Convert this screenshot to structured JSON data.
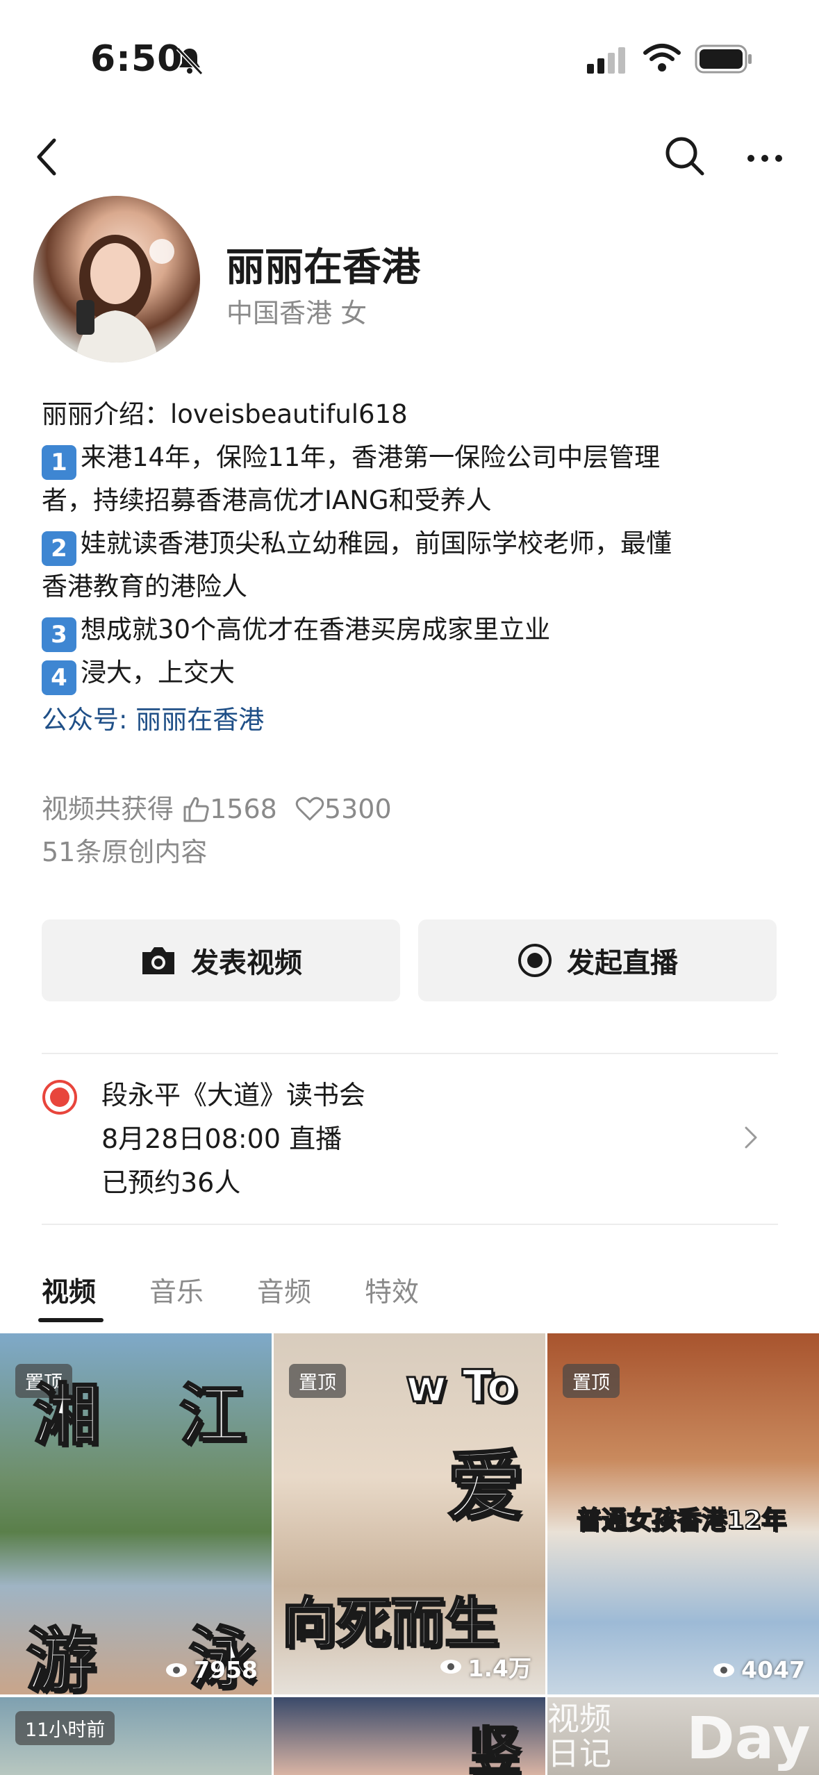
{
  "status_bar": {
    "time": "6:50"
  },
  "profile": {
    "name": "丽丽在香港",
    "location": "中国香港 女",
    "bio": {
      "intro": "丽丽介绍：loveisbeautiful618",
      "points": [
        {
          "num": "1",
          "lines": [
            "来港14年，保险11年，香港第一保险公司中层管理",
            "者，持续招募香港高优才IANG和受养人"
          ]
        },
        {
          "num": "2",
          "lines": [
            "娃就读香港顶尖私立幼稚园，前国际学校老师，最懂",
            "香港教育的港险人"
          ]
        },
        {
          "num": "3",
          "lines": [
            "想成就30个高优才在香港买房成家里立业"
          ]
        },
        {
          "num": "4",
          "lines": [
            "浸大，上交大"
          ]
        }
      ],
      "official_account": "公众号: 丽丽在香港"
    },
    "stats": {
      "prefix": "视频共获得",
      "likes": "1568",
      "hearts": "5300",
      "original": "51条原创内容"
    }
  },
  "actions": {
    "post_video": "发表视频",
    "go_live": "发起直播"
  },
  "live_event": {
    "title": "段永平《大道》读书会",
    "time": "8月28日08:00 直播",
    "reserved": "已预约36人"
  },
  "tabs": [
    "视频",
    "音乐",
    "音频",
    "特效"
  ],
  "videos": [
    {
      "badge": "置顶",
      "views": "7958",
      "overlay": [
        "湘",
        "江",
        "游",
        "泳"
      ]
    },
    {
      "badge": "置顶",
      "views": "1.4万",
      "overlay": [
        "w To",
        "爱",
        "向死而生"
      ]
    },
    {
      "badge": "置顶",
      "views": "4047",
      "overlay": [
        "普通女孩香港12年"
      ]
    },
    {
      "badge": "11小时前",
      "views": "",
      "overlay": []
    },
    {
      "badge": "",
      "views": "",
      "overlay": [
        "竖"
      ]
    },
    {
      "badge": "",
      "views": "",
      "overlay": [
        "视频",
        "日记",
        "Day"
      ]
    }
  ],
  "colors": {
    "accent_blue": "#3e86d2",
    "link": "#1f4f87",
    "live_red": "#e8453c"
  }
}
